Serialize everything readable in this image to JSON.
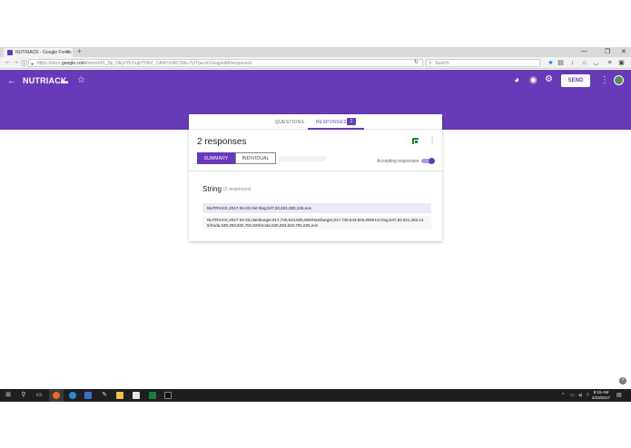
{
  "browser": {
    "tab_title": "NUTRIACK - Google Forms",
    "url_prefix": "https://docs.",
    "url_domain": "google.com",
    "url_rest": "/forms/d/1_8p_OEjVYk1rujnTOhV_CANYmWCS8u-7yiTpa-m1Gwg/edit#responses",
    "search_placeholder": "Search"
  },
  "header": {
    "form_title": "NUTRIACK",
    "send_label": "SEND",
    "accent_color": "#673ab7"
  },
  "tabs": {
    "questions_label": "QUESTIONS",
    "responses_label": "RESPONSES",
    "responses_count": "2"
  },
  "summary": {
    "title": "2 responses",
    "summary_label": "SUMMARY",
    "individual_label": "INDIVIDUAL",
    "accepting_label": "Accepting responses",
    "accepting_enabled": true
  },
  "question": {
    "title": "String",
    "count_label": "(2 responses)",
    "responses": [
      "NUTRIACK,2017-04-22,Hot Dog,547,82,621,383,136,eos",
      "NUTRIACK,2017-04-23,Hamburger,917,746,643,825,806/Hamburger,917,746,643,825,806/Hot Dog,547,82,621,383,136/Soda,530,253,634,781,625/Soda,530,253,634,781,625,eos"
    ]
  },
  "taskbar": {
    "time": "9:15 AM",
    "date": "4/23/2017"
  }
}
